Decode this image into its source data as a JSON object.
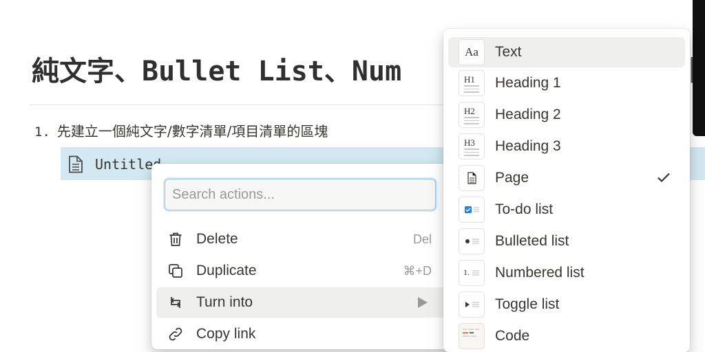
{
  "page": {
    "title": "純文字、Bullet List、Num",
    "numbered_item": {
      "number": "1.",
      "text": "先建立一個純文字/數字清單/項目清單的區塊"
    },
    "page_link_text": "Untitled"
  },
  "actions_menu": {
    "search_placeholder": "Search actions...",
    "items": [
      {
        "label": "Delete",
        "shortcut": "Del",
        "icon": "trash-icon"
      },
      {
        "label": "Duplicate",
        "shortcut": "⌘+D",
        "icon": "duplicate-icon"
      },
      {
        "label": "Turn into",
        "icon": "turn-into-icon",
        "has_submenu": true
      },
      {
        "label": "Copy link",
        "icon": "link-icon"
      }
    ]
  },
  "turn_into_menu": {
    "items": [
      {
        "label": "Text",
        "thumb": "Aa"
      },
      {
        "label": "Heading 1",
        "thumb": "H1"
      },
      {
        "label": "Heading 2",
        "thumb": "H2"
      },
      {
        "label": "Heading 3",
        "thumb": "H3"
      },
      {
        "label": "Page",
        "checked": true
      },
      {
        "label": "To-do list"
      },
      {
        "label": "Bulleted list"
      },
      {
        "label": "Numbered list",
        "thumb": "1."
      },
      {
        "label": "Toggle list"
      },
      {
        "label": "Code"
      }
    ]
  },
  "colors": {
    "selection": "#d3e8f2",
    "hover": "#efefee",
    "accent": "#2383e2",
    "text": "#37352f",
    "muted": "#9b9a97"
  }
}
